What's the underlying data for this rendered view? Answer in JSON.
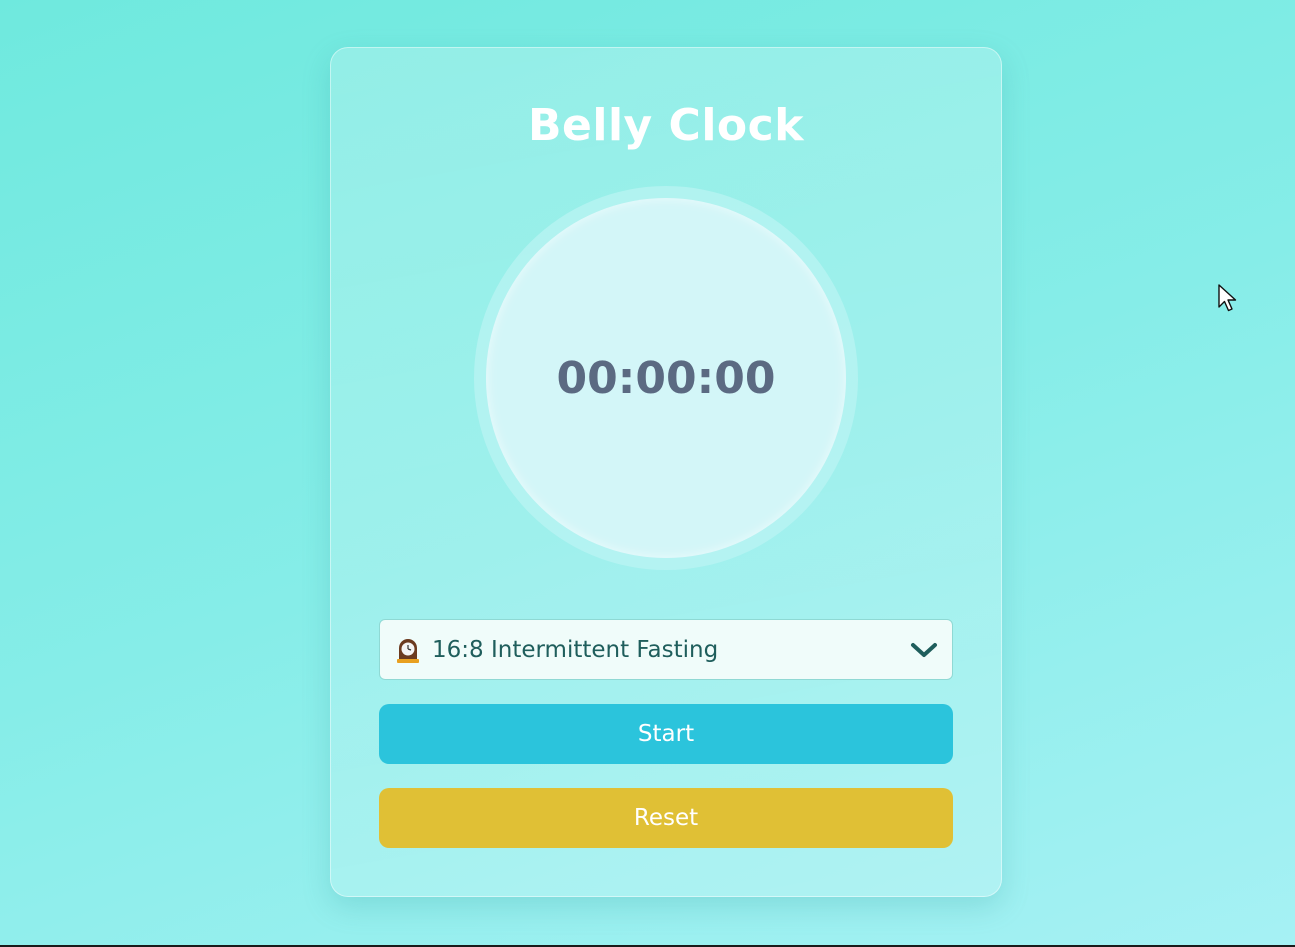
{
  "app": {
    "title": "Belly Clock"
  },
  "timer": {
    "display": "00:00:00"
  },
  "plan_select": {
    "icon": "mantelpiece-clock-icon",
    "selected": "16:8 Intermittent Fasting"
  },
  "buttons": {
    "start_label": "Start",
    "reset_label": "Reset"
  },
  "colors": {
    "background_start": "#6fe9de",
    "background_end": "#a6f1f4",
    "start_button": "#2bc4dc",
    "reset_button": "#e0c035",
    "timer_text": "#5b6a82"
  }
}
